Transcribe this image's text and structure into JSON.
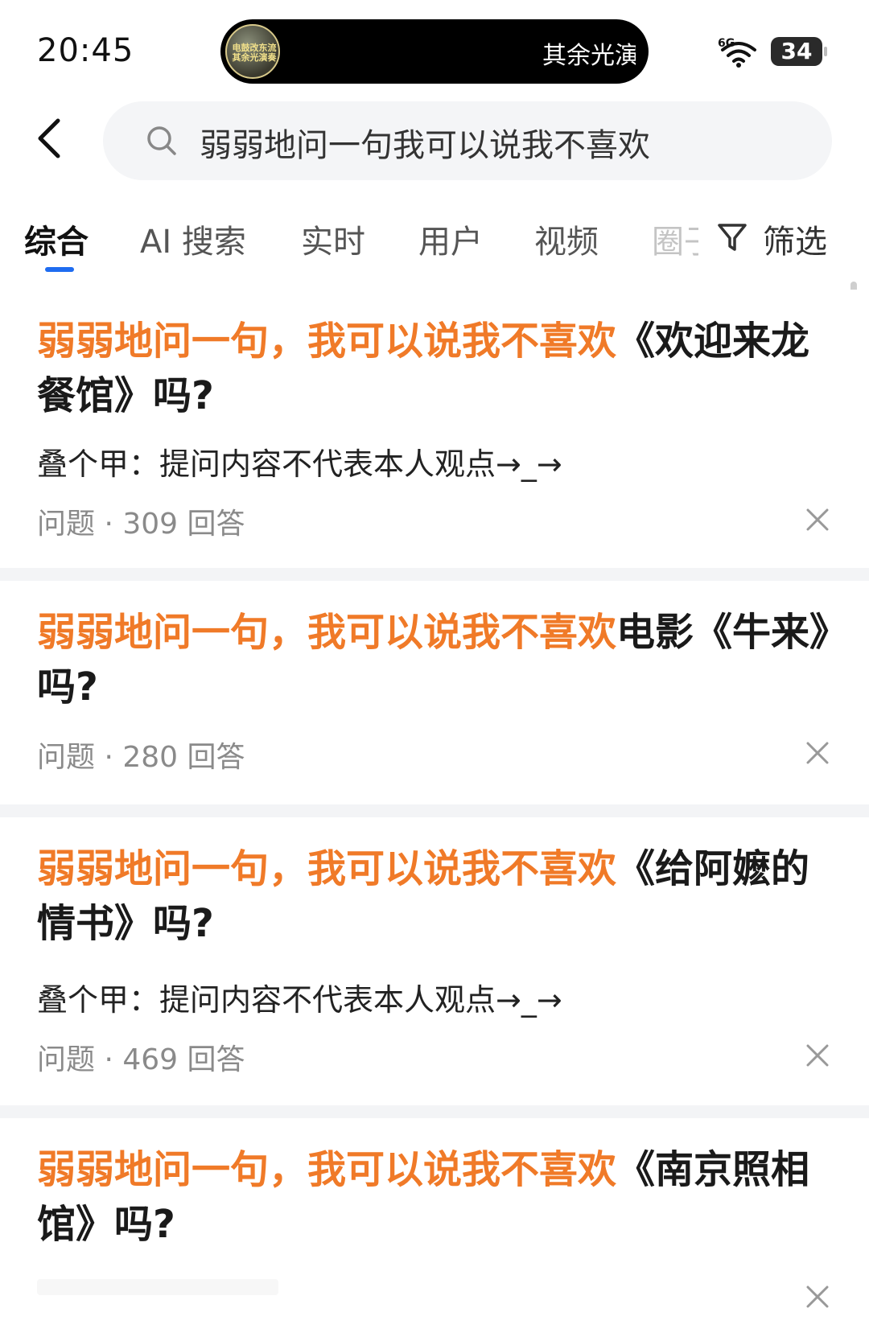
{
  "status_bar": {
    "time": "20:45",
    "island_text": "其余光演",
    "island_thumb_text": "电鼓改东流 其余光演奏",
    "network": "6G",
    "battery": "34"
  },
  "search": {
    "query": "弱弱地问一句我可以说我不喜欢"
  },
  "tabs": {
    "items": [
      "综合",
      "AI 搜索",
      "实时",
      "用户",
      "视频",
      "圈子"
    ],
    "active": "综合",
    "filter_label": "筛选"
  },
  "results": [
    {
      "title_highlight": "弱弱地问一句，我可以说我不喜欢",
      "title_rest": "《欢迎来龙餐馆》吗?",
      "excerpt": "叠个甲：提问内容不代表本人观点→_→",
      "meta": "问题 · 309 回答"
    },
    {
      "title_highlight": "弱弱地问一句，我可以说我不喜欢",
      "title_rest": "电影《牛来》吗?",
      "excerpt": "",
      "meta": "问题 · 280 回答"
    },
    {
      "title_highlight": "弱弱地问一句，我可以说我不喜欢",
      "title_rest": "《给阿嬷的情书》吗?",
      "excerpt": "叠个甲：提问内容不代表本人观点→_→",
      "meta": "问题 · 469 回答"
    },
    {
      "title_highlight": "弱弱地问一句，我可以说我不喜欢",
      "title_rest": "《南京照相馆》吗?",
      "excerpt": "",
      "meta": ""
    }
  ],
  "colors": {
    "highlight": "#f07a28",
    "accent": "#1f6cf0"
  },
  "icons": {
    "back": "chevron-left-icon",
    "search": "search-icon",
    "filter": "filter-icon",
    "close": "close-icon",
    "wifi": "wifi-icon"
  }
}
